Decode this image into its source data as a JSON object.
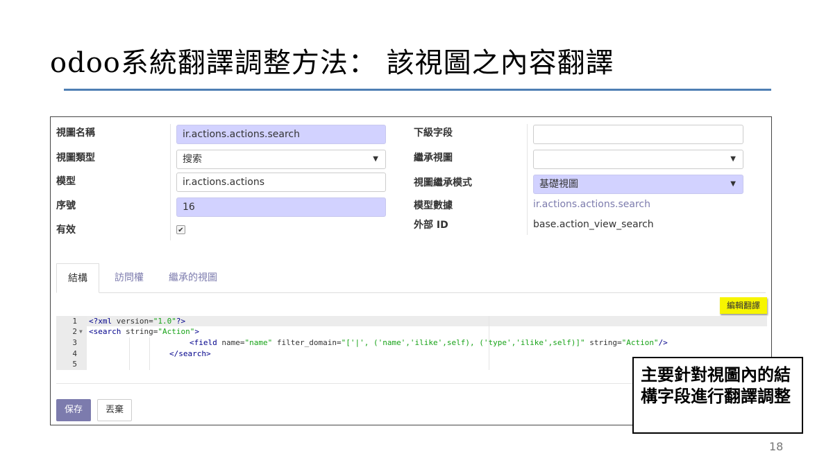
{
  "slide": {
    "title": "odoo系統翻譯調整方法： 該視圖之內容翻譯",
    "page_number": "18",
    "callout": "主要針對視圖內的結構字段進行翻譯調整"
  },
  "form": {
    "view_name_label": "視圖名稱",
    "view_name_value": "ir.actions.actions.search",
    "view_type_label": "視圖類型",
    "view_type_value": "搜索",
    "model_label": "模型",
    "model_value": "ir.actions.actions",
    "sequence_label": "序號",
    "sequence_value": "16",
    "active_label": "有效",
    "active_checked": true,
    "child_field_label": "下級字段",
    "child_field_value": "",
    "inherit_view_label": "繼承視圖",
    "inherit_view_value": "",
    "inherit_mode_label": "視圖繼承模式",
    "inherit_mode_value": "基礎視圖",
    "model_data_label": "模型數據",
    "model_data_value": "ir.actions.actions.search",
    "external_id_label": "外部 ID",
    "external_id_value": "base.action_view_search"
  },
  "tabs": [
    {
      "label": "結構",
      "active": true
    },
    {
      "label": "訪問權",
      "active": false
    },
    {
      "label": "繼承的視圖",
      "active": false
    }
  ],
  "editor": {
    "edit_translation_label": "編輯翻譯",
    "line_numbers": [
      "1",
      "2",
      "3",
      "4",
      "5"
    ]
  },
  "buttons": {
    "save_label": "保存",
    "discard_label": "丟棄"
  },
  "colors": {
    "accent": "#7c7bad",
    "required_field": "#d2d2ff",
    "highlight_button": "#f7f500",
    "title_rule": "#4f7fb4"
  }
}
